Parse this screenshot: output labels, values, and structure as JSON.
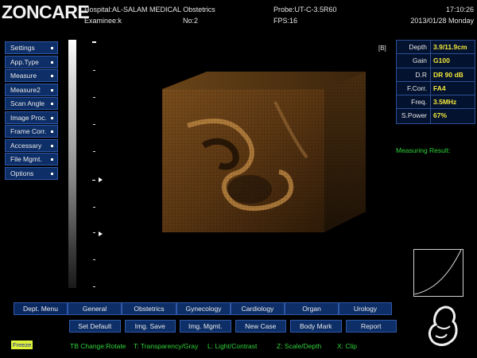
{
  "header": {
    "logo": "ZONCARE",
    "hospital": "Hospital:AL-SALAM MEDICAL Obstetrics",
    "examinee": "Examinee:k",
    "number": "No:2",
    "probe": "Probe:UT-C-3.5R60",
    "fps": "FPS:16",
    "time": "17:10:26",
    "date": "2013/01/28 Monday"
  },
  "image_marker": "[B]",
  "menu": {
    "items": [
      {
        "label": "Settings"
      },
      {
        "label": "App.Type"
      },
      {
        "label": "Measure"
      },
      {
        "label": "Measure2"
      },
      {
        "label": "Scan Angle"
      },
      {
        "label": "Image Proc."
      },
      {
        "label": "Frame Corr."
      },
      {
        "label": "Accessary"
      },
      {
        "label": "File Mgmt."
      },
      {
        "label": "Options"
      }
    ]
  },
  "params": [
    {
      "label": "Depth",
      "value": "3.9/11.9cm"
    },
    {
      "label": "Gain",
      "value": "G100"
    },
    {
      "label": "D.R",
      "value": "DR 90 dB"
    },
    {
      "label": "F.Corr.",
      "value": "FA4"
    },
    {
      "label": "Freq.",
      "value": "3.5MHz"
    },
    {
      "label": "S.Power",
      "value": "67%"
    }
  ],
  "measuring_result": "Measuring Result:",
  "dept_menu": {
    "label": "Dept. Menu",
    "tabs": [
      "General",
      "Obstetrics",
      "Gynecology",
      "Cardiology",
      "Organ",
      "Urology"
    ]
  },
  "buttons": [
    "Set Default",
    "Img. Save",
    "Img. Mgmt.",
    "New Case",
    "Body Mark",
    "Report"
  ],
  "freeze": "Freeze",
  "hints": {
    "tb": "TB Change:Rotate",
    "t": "T: Transparency/Gray",
    "l": "L: Light/Contrast",
    "z": "Z: Scale/Depth",
    "x": "X: Clip"
  },
  "colors": {
    "panel_bg": "#0d2e66",
    "panel_border": "#2f58a8",
    "value_yellow": "#f4e83a",
    "status_green": "#2fd23a",
    "volume_tint": "#8a5a22"
  },
  "icons": [
    "fetus-icon",
    "curve-icon"
  ]
}
